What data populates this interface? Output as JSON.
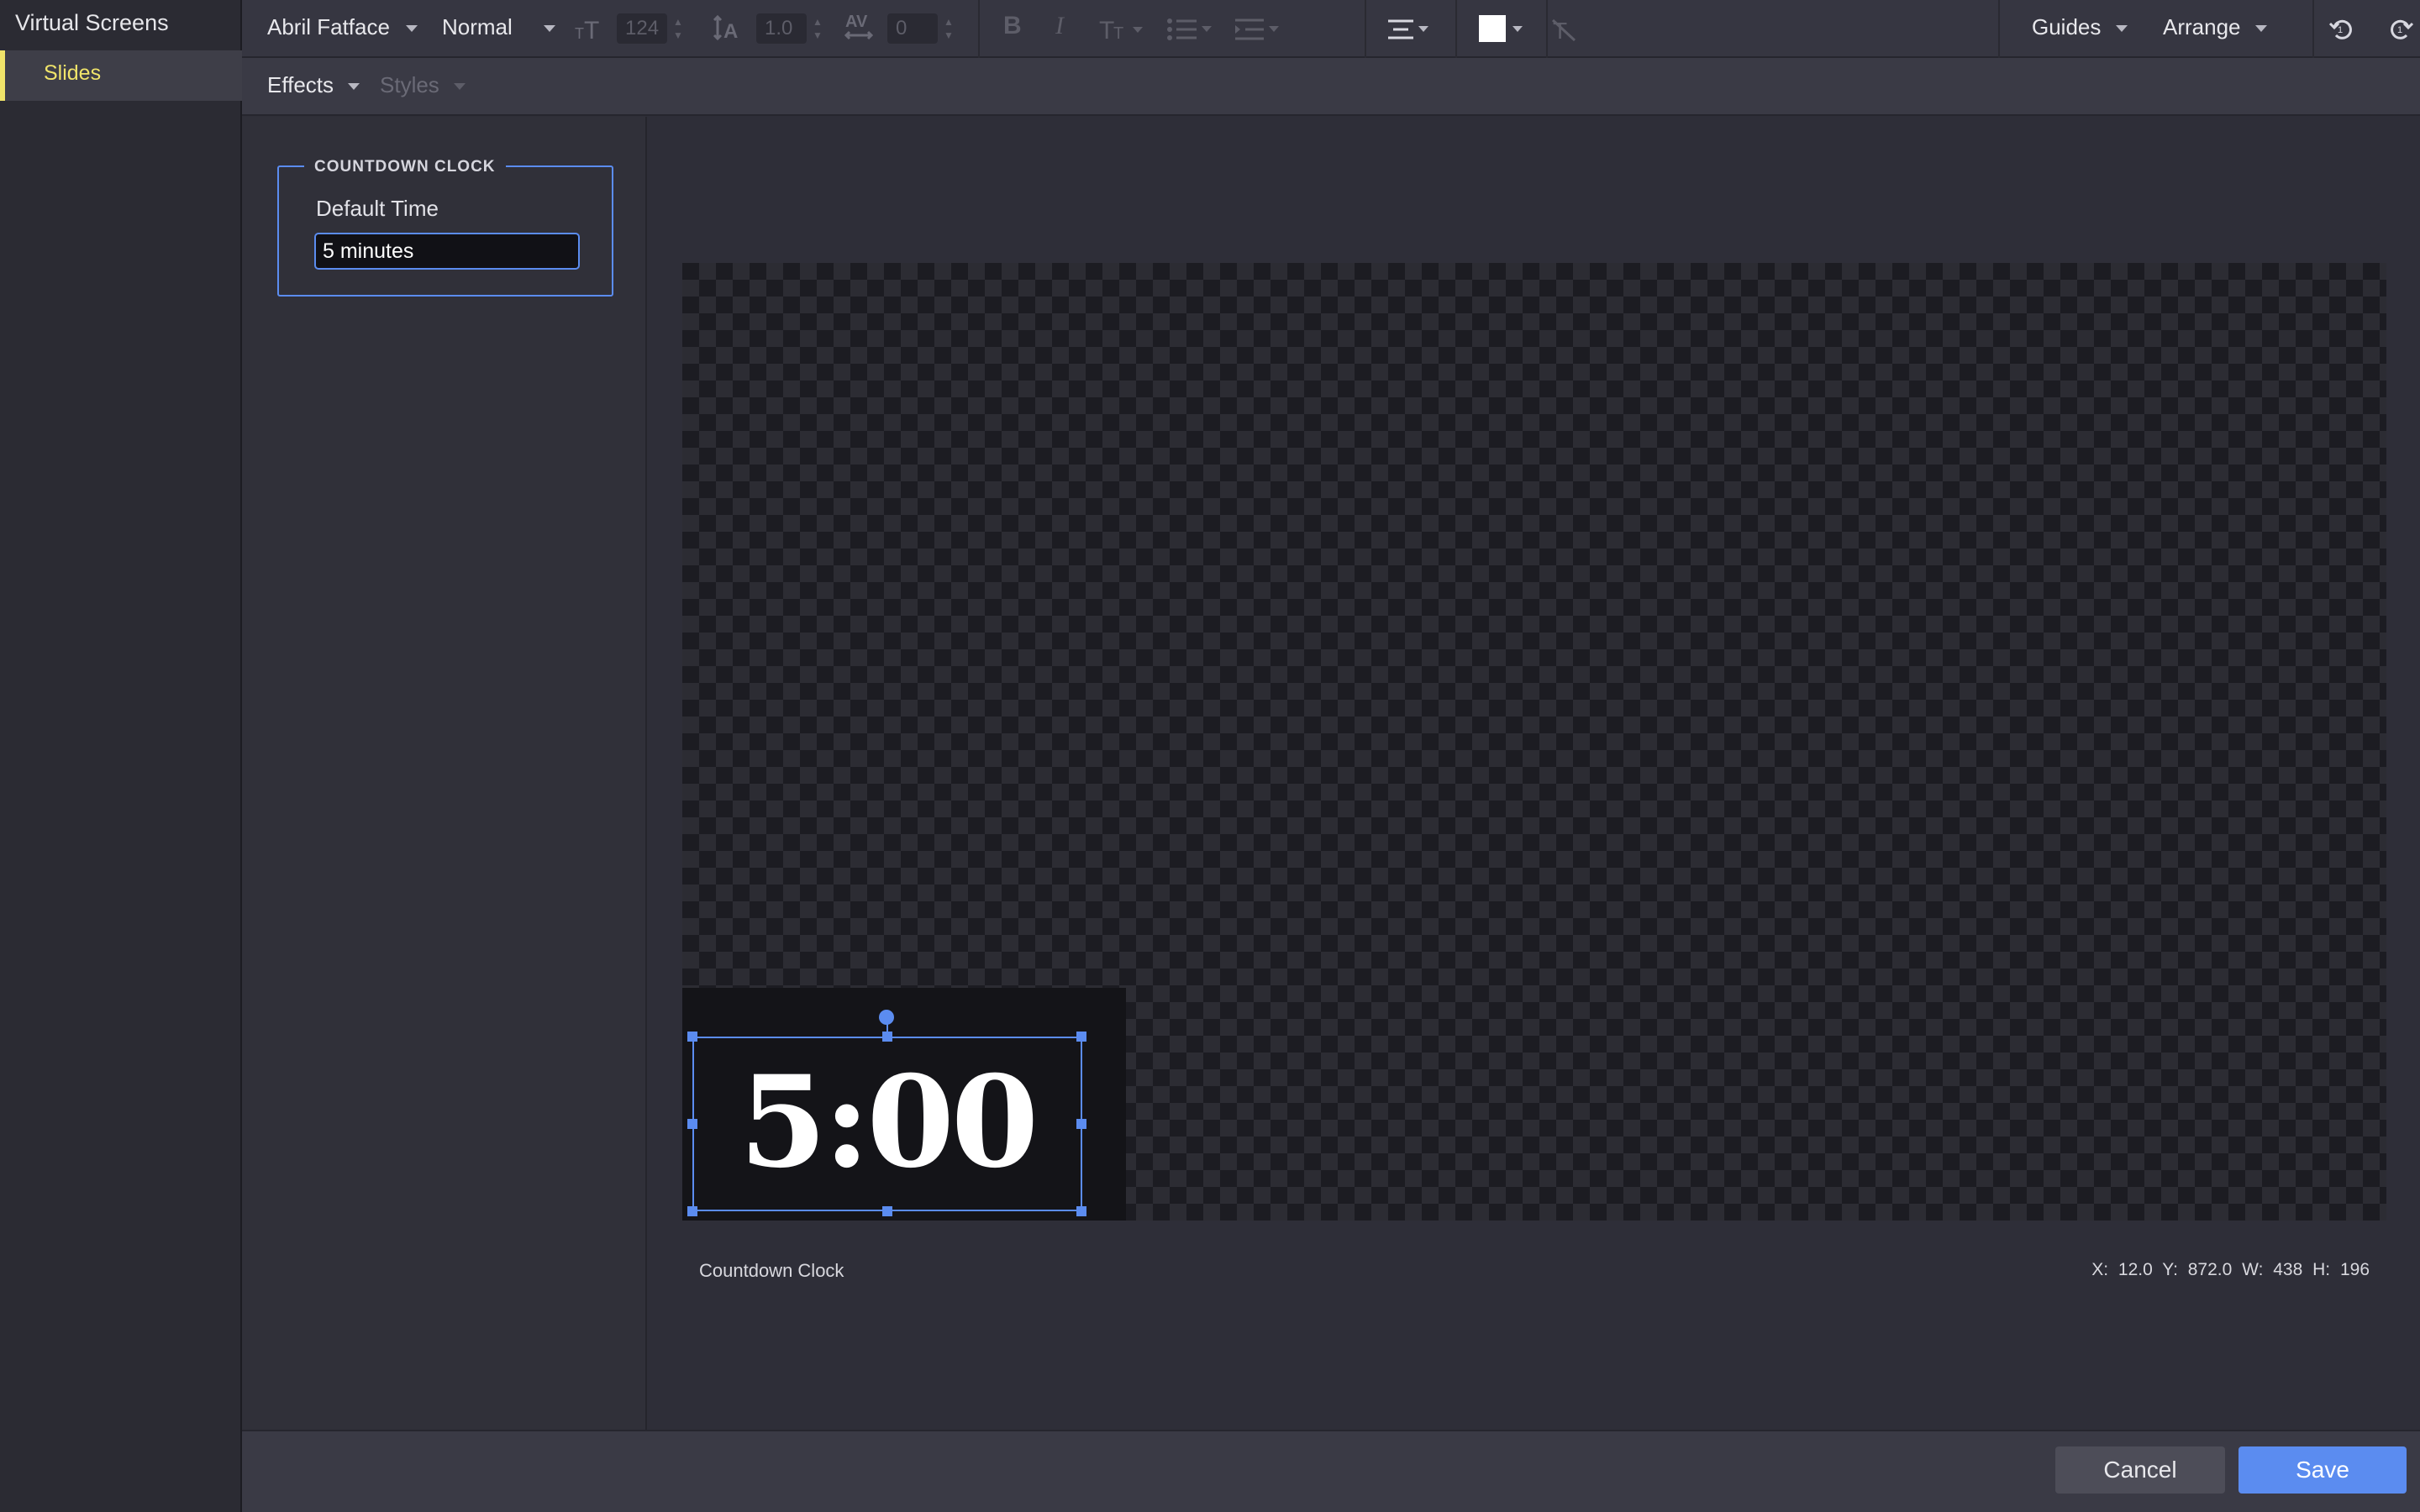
{
  "app": {
    "title": "Virtual Screens"
  },
  "sidebar": {
    "items": [
      {
        "label": "Slides",
        "active": true
      }
    ]
  },
  "toolbar": {
    "font_family": "Abril Fatface",
    "font_weight": "Normal",
    "font_size": "124",
    "line_height": "1.0",
    "letter_spacing": "0",
    "guides_label": "Guides",
    "arrange_label": "Arrange",
    "fill_color": "#ffffff"
  },
  "subtoolbar": {
    "effects_label": "Effects",
    "styles_label": "Styles"
  },
  "panel": {
    "section_title": "COUNTDOWN CLOCK",
    "field_label": "Default Time",
    "field_value": "5 minutes"
  },
  "canvas": {
    "clock_text": "5:00",
    "element_name": "Countdown Clock",
    "coords_text": "X: 12.0  Y: 872.0   W: 438  H: 196"
  },
  "footer": {
    "cancel_label": "Cancel",
    "save_label": "Save"
  },
  "colors": {
    "accent": "#5b8cf0",
    "active_nav": "#f0e46a",
    "background": "#2e2e38"
  }
}
